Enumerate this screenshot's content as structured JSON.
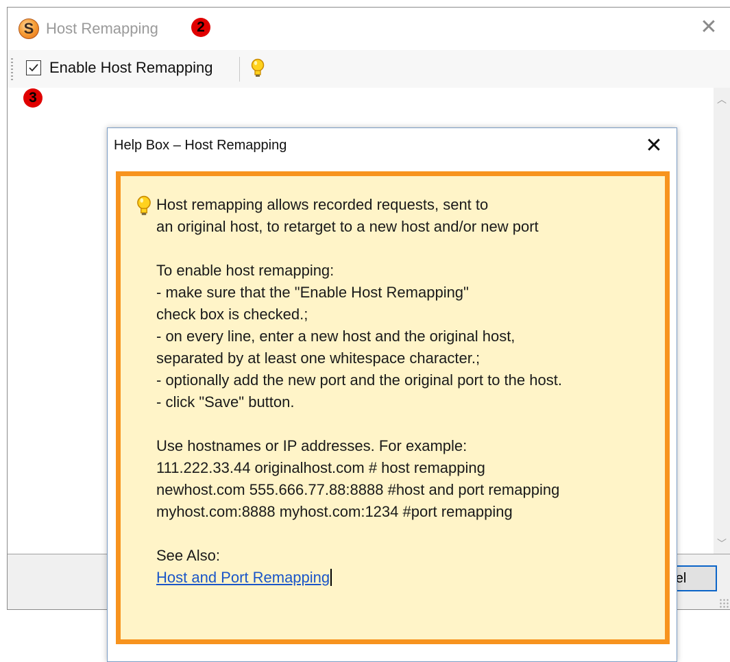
{
  "window": {
    "title": "Host Remapping",
    "logo_letter": "S",
    "close_glyph": "✕"
  },
  "badges": [
    "2",
    "3"
  ],
  "toolbar": {
    "enable_label": "Enable Host Remapping",
    "enable_checked": true,
    "hint_icon": "lightbulb-icon"
  },
  "footer": {
    "cancel_label": "el"
  },
  "help": {
    "title": "Help Box – Host Remapping",
    "close_glyph": "✕",
    "intro": [
      "Host remapping allows recorded requests, sent to",
      "an original host, to retarget to a new host and/or new port"
    ],
    "steps": [
      "To enable host remapping:",
      "- make sure that the \"Enable Host Remapping\"",
      "check box is checked.;",
      "- on every line, enter a new host and the original host,",
      "separated by at least one whitespace character.;",
      "- optionally add the new port and the original port to the host.",
      "- click \"Save\" button."
    ],
    "examples": [
      "Use hostnames or IP addresses. For example:",
      "111.222.33.44 originalhost.com # host remapping",
      "newhost.com 555.666.77.88:8888 #host and port remapping",
      "myhost.com:8888 myhost.com:1234 #port remapping"
    ],
    "see_also_label": "See Also:",
    "see_also_link": "Host and Port Remapping"
  },
  "colors": {
    "accent_orange": "#f7931e",
    "help_background": "#fff4c8",
    "link_blue": "#1a55c8",
    "badge_red": "#e00000"
  }
}
